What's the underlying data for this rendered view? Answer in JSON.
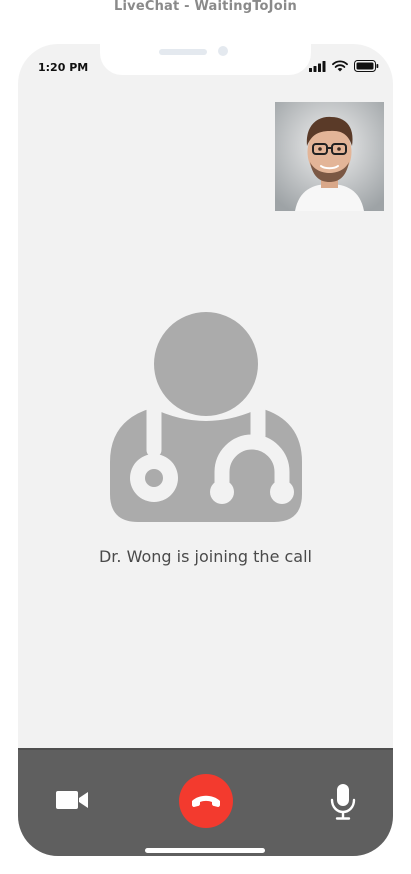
{
  "screen": {
    "title": "LiveChat - WaitingToJoin"
  },
  "status_bar": {
    "time": "1:20 PM",
    "icons": [
      "cellular-signal-icon",
      "wifi-icon",
      "battery-icon"
    ]
  },
  "call": {
    "self_view_icon": "user-photo",
    "doctor_icon": "doctor-avatar-icon",
    "status_message": "Dr. Wong is joining the call"
  },
  "controls": {
    "video_icon": "video-camera-icon",
    "end_call_icon": "phone-hangup-icon",
    "mic_icon": "microphone-icon"
  },
  "colors": {
    "background": "#f2f2f2",
    "control_bar": "#5f5f5f",
    "end_call": "#f33a2e",
    "avatar_gray": "#ababab"
  }
}
